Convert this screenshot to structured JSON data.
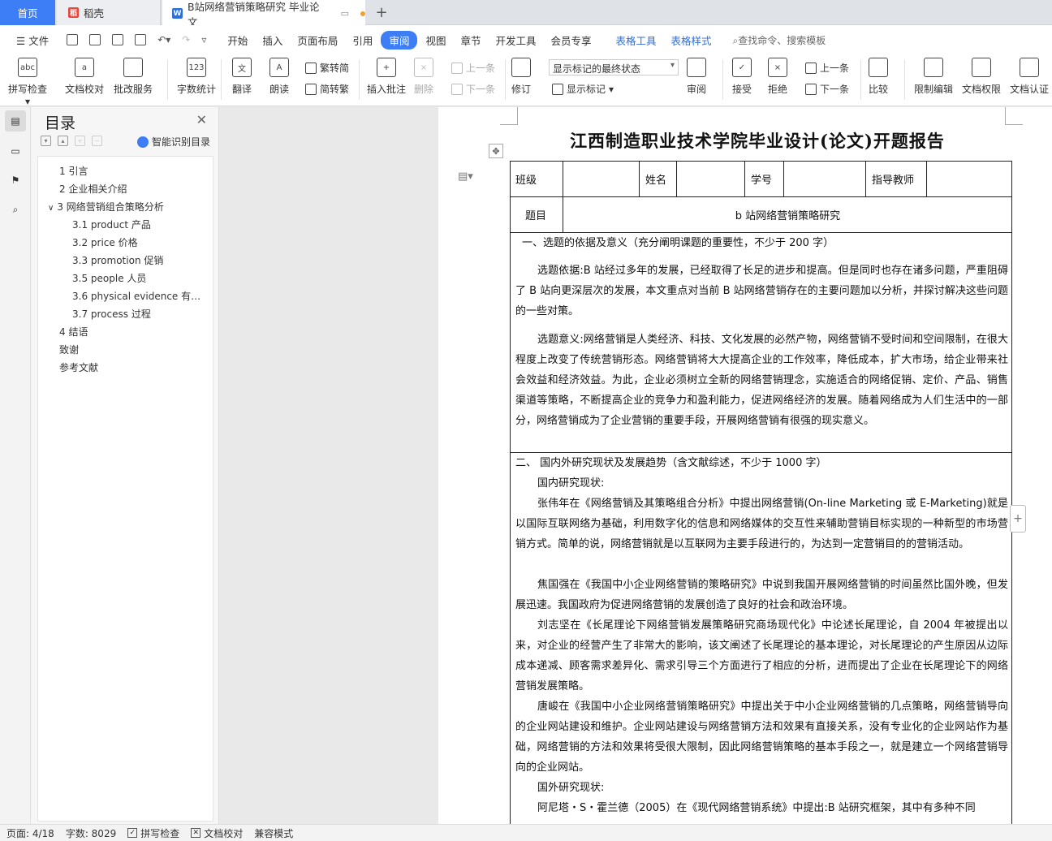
{
  "tabs": {
    "home": "首页",
    "doc1": "稻壳",
    "doc2": "B站网络营销策略研究 毕业论文",
    "new_tab": "+"
  },
  "menu": {
    "file": "文件",
    "items": [
      "开始",
      "插入",
      "页面布局",
      "引用",
      "审阅",
      "视图",
      "章节",
      "开发工具",
      "会员专享"
    ],
    "active": "审阅",
    "table_tools": "表格工具",
    "table_style": "表格样式",
    "search": "查找命令、搜索模板"
  },
  "ribbon": {
    "spell_check": "拼写检查",
    "doc_check": "文档校对",
    "revise_service": "批改服务",
    "word_count": "字数统计",
    "translate": "翻译",
    "read_aloud": "朗读",
    "trad_to_simp": "繁转简",
    "simp_to_trad": "简转繁",
    "insert_comment": "插入批注",
    "delete": "删除",
    "prev_comment": "上一条",
    "next_comment": "下一条",
    "track_changes": "修订",
    "markup_select": "显示标记的最终状态",
    "show_markup": "显示标记",
    "review": "审阅",
    "accept": "接受",
    "reject": "拒绝",
    "prev_change": "上一条",
    "next_change": "下一条",
    "compare": "比较",
    "restrict_edit": "限制编辑",
    "doc_permission": "文档权限",
    "doc_cert": "文档认证"
  },
  "toc": {
    "title": "目录",
    "smart": "智能识别目录",
    "items": [
      "1 引言",
      "2 企业相关介绍",
      "3 网络营销组合策略分析",
      "3.1 product 产品",
      "3.2 price 价格",
      "3.3 promotion 促销",
      "3.5 people 人员",
      "3.6 physical evidence 有…",
      "3.7 process 过程",
      "4 结语",
      "致谢",
      "参考文献"
    ]
  },
  "document": {
    "title": "江西制造职业技术学院毕业设计(论文)开题报告",
    "header_row": [
      "班级",
      "姓名",
      "学号",
      "指导教师"
    ],
    "topic_label": "题目",
    "topic_value": "b 站网络营销策略研究",
    "section1_heading": "一、选题的依据及意义（充分阐明课题的重要性，不少于 200 字）",
    "section1_p1": "选题依据:B 站经过多年的发展，已经取得了长足的进步和提高。但是同时也存在诸多问题，严重阻碍了 B 站向更深层次的发展，本文重点对当前 B 站网络营销存在的主要问题加以分析，并探讨解决这些问题的一些对策。",
    "section1_p2": "选题意义:网络营销是人类经济、科技、文化发展的必然产物，网络营销不受时间和空间限制，在很大程度上改变了传统营销形态。网络营销将大大提高企业的工作效率，降低成本，扩大市场，给企业带来社会效益和经济效益。为此，企业必须树立全新的网络营销理念，实施适合的网络促销、定价、产品、销售渠道等策略，不断提高企业的竞争力和盈利能力，促进网络经济的发展。随着网络成为人们生活中的一部分，网络营销成为了企业营销的重要手段，开展网络营销有很强的现实意义。",
    "section2_heading": "二、  国内外研究现状及发展趋势（含文献综述，不少于 1000 字）",
    "domestic": "国内研究现状:",
    "s2_p1": "张伟年在《网络营销及其策略组合分析》中提出网络营销(On-line Marketing 或 E-Marketing)就是以国际互联网络为基础，利用数字化的信息和网络媒体的交互性来辅助营销目标实现的一种新型的市场营销方式。简单的说，网络营销就是以互联网为主要手段进行的，为达到一定营销目的的营销活动。",
    "s2_p2": "焦国强在《我国中小企业网络营销的策略研究》中说到我国开展网络营销的时间虽然比国外晚，但发展迅速。我国政府为促进网络营销的发展创造了良好的社会和政治环境。",
    "s2_p3": "刘志坚在《长尾理论下网络营销发展策略研究商场现代化》中论述长尾理论，自 2004 年被提出以来，对企业的经营产生了非常大的影响，该文阐述了长尾理论的基本理论，对长尾理论的产生原因从边际成本递减、顾客需求差异化、需求引导三个方面进行了相应的分析，进而提出了企业在长尾理论下的网络营销发展策略。",
    "s2_p4": "唐峻在《我国中小企业网络营销策略研究》中提出关于中小企业网络营销的几点策略，网络营销导向的企业网站建设和维护。企业网站建设与网络营销方法和效果有直接关系，没有专业化的企业网站作为基础，网络营销的方法和效果将受很大限制，因此网络营销策略的基本手段之一，就是建立一个网络营销导向的企业网站。",
    "foreign": "国外研究现状:",
    "s2_p5": "阿尼塔・S・霍兰德（2005）在《现代网络营销系统》中提出:B 站研究框架，其中有多种不同"
  },
  "status": {
    "page": "页面: 4/18",
    "words": "字数: 8029",
    "spell": "拼写检查",
    "proof": "文档校对",
    "compat": "兼容模式"
  },
  "colors": {
    "accent": "#3d7ef7",
    "table_tools": "#2f6fd9"
  }
}
